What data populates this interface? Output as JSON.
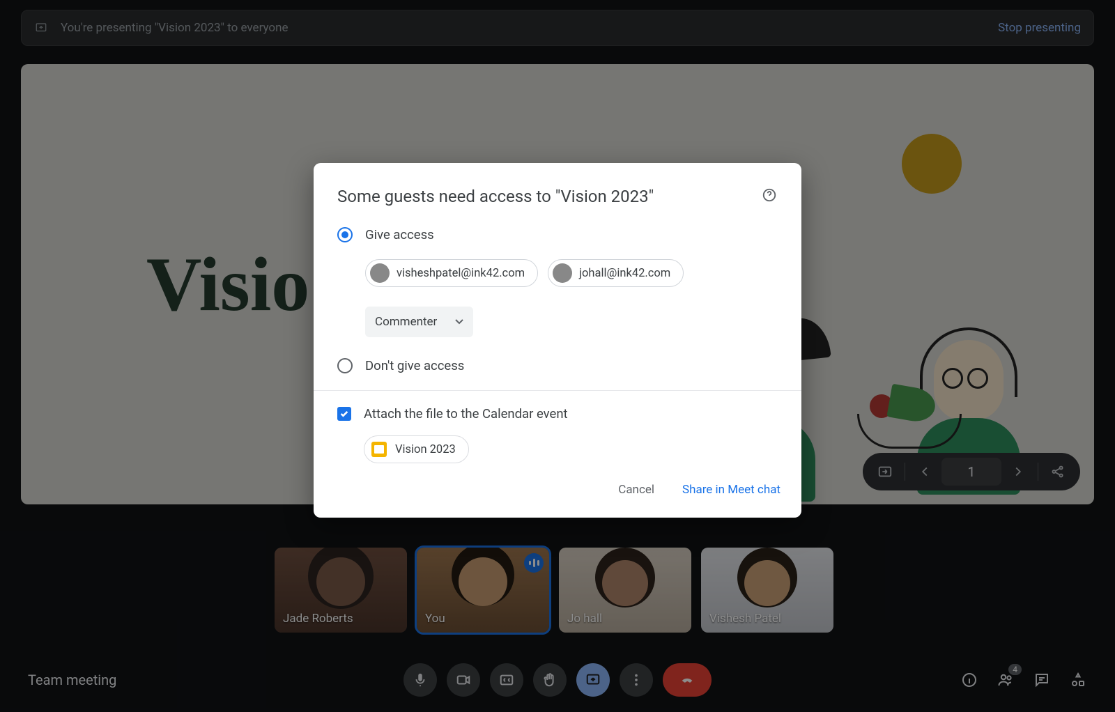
{
  "banner": {
    "text": "You're presenting \"Vision 2023\" to everyone",
    "stop": "Stop presenting"
  },
  "slide": {
    "title": "Visio"
  },
  "slide_toolbar": {
    "page": "1"
  },
  "tiles": [
    {
      "name": "Jade Roberts"
    },
    {
      "name": "You"
    },
    {
      "name": "Jo hall"
    },
    {
      "name": "Vishesh Patel"
    }
  ],
  "meeting": {
    "name": "Team meeting",
    "participant_count": "4"
  },
  "dialog": {
    "title": "Some guests need access to \"Vision 2023\"",
    "give": "Give access",
    "dont": "Don't give access",
    "role": "Commenter",
    "guests": [
      "visheshpatel@ink42.com",
      "johall@ink42.com"
    ],
    "attach_label": "Attach the file to the Calendar event",
    "file_name": "Vision 2023",
    "cancel": "Cancel",
    "share": "Share in Meet chat"
  }
}
